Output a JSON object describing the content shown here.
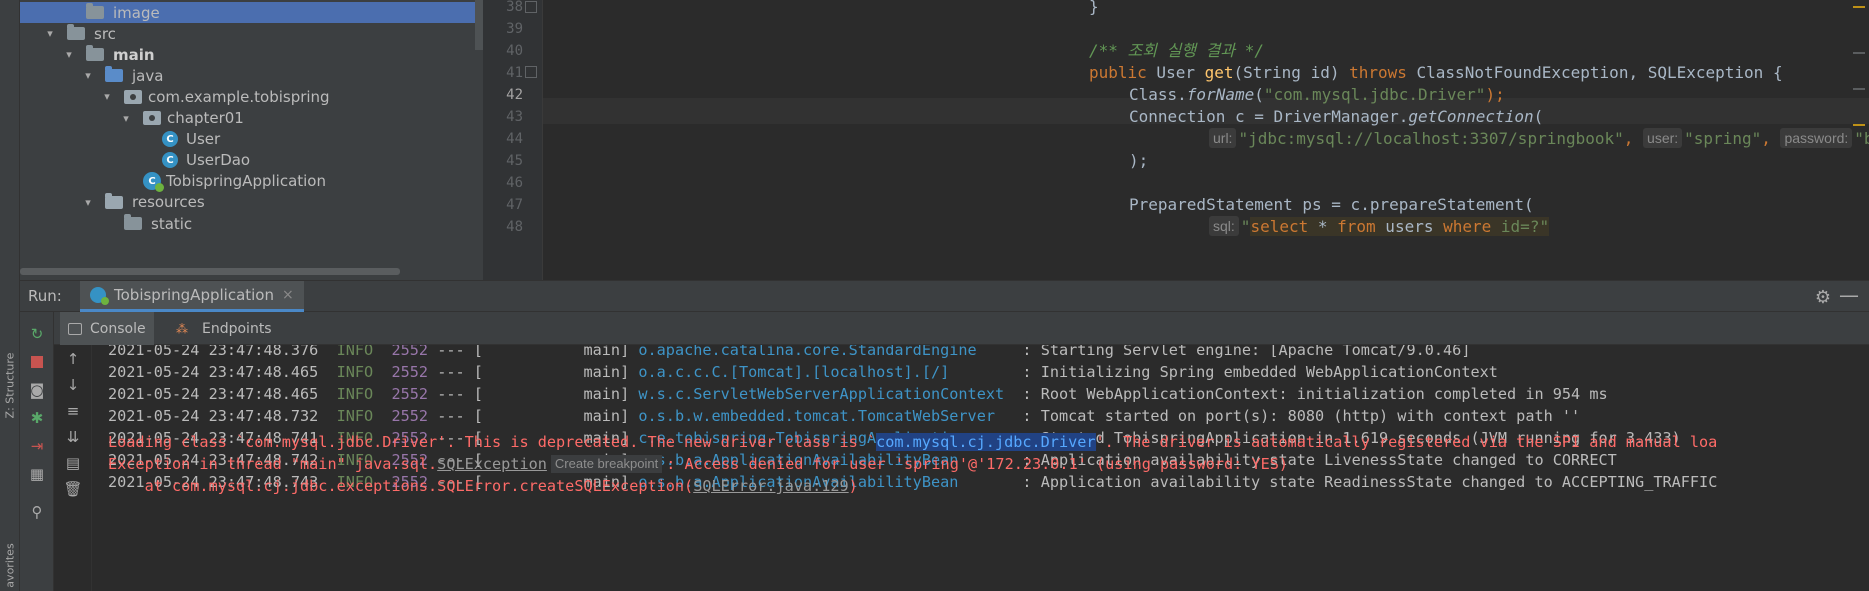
{
  "left_strip": {
    "structure_label": "Z: Structure",
    "favorites_label": "avorites"
  },
  "project_tree": {
    "items": [
      {
        "label": "image",
        "depth": 2,
        "arrow": "",
        "icon": "folder",
        "selected": true
      },
      {
        "label": "src",
        "depth": 1,
        "arrow": "▾",
        "icon": "folder"
      },
      {
        "label": "main",
        "depth": 2,
        "arrow": "▾",
        "icon": "folder"
      },
      {
        "label": "java",
        "depth": 3,
        "arrow": "▾",
        "icon": "folder"
      },
      {
        "label": "com.example.tobispring",
        "depth": 4,
        "arrow": "▾",
        "icon": "package"
      },
      {
        "label": "chapter01",
        "depth": 5,
        "arrow": "▾",
        "icon": "package"
      },
      {
        "label": "User",
        "depth": 6,
        "arrow": "",
        "icon": "class"
      },
      {
        "label": "UserDao",
        "depth": 6,
        "arrow": "",
        "icon": "class"
      },
      {
        "label": "TobispringApplication",
        "depth": 5,
        "arrow": "",
        "icon": "spring"
      },
      {
        "label": "resources",
        "depth": 3,
        "arrow": "▾",
        "icon": "folder"
      },
      {
        "label": "static",
        "depth": 4,
        "arrow": "",
        "icon": "folder"
      }
    ]
  },
  "editor": {
    "line_numbers": [
      "38",
      "39",
      "40",
      "41",
      "42",
      "43",
      "44",
      "45",
      "46",
      "47",
      "48"
    ],
    "current_line": "42",
    "code": {
      "l38": "}",
      "l40_comment": "/** 조회 실행 결과 */",
      "l41_public": "public",
      "l41_type": " User ",
      "l41_method": "get",
      "l41_params": "(String id) ",
      "l41_throws": "throws",
      "l41_rest": " ClassNotFoundException, SQLException {",
      "l42_class": "Class.",
      "l42_forname": "forName",
      "l42_paren": "(",
      "l42_str": "\"com.mysql.jdbc.Driver\"",
      "l42_end": ");",
      "l43_a": "Connection c = DriverManager.",
      "l43_getconn": "getConnection",
      "l43_paren": "(",
      "l44_hint_url": "url:",
      "l44_url": "\"jdbc:mysql://localhost:3307/springbook\"",
      "l44_comma1": ", ",
      "l44_hint_user": "user:",
      "l44_user": "\"spring\"",
      "l44_comma2": ", ",
      "l44_hint_pass": "password:",
      "l44_pass": "\"book\"",
      "l45": ");",
      "l47": "PreparedStatement ps = c.prepareStatement(",
      "l48_hint": "sql:",
      "l48_q1": "\"",
      "l48_select": "select",
      "l48_star": " * ",
      "l48_from": "from",
      "l48_users": " users ",
      "l48_where": "where",
      "l48_rest": " id=?\""
    }
  },
  "run_window": {
    "title": "Run:",
    "tab_label": "TobispringApplication",
    "tab_close": "×",
    "gear": "⚙",
    "minimize": "—"
  },
  "console_tabs": {
    "console": "Console",
    "endpoints": "Endpoints"
  },
  "console": {
    "log_lines": [
      {
        "ts": "2021-05-24 23:47:48.376",
        "level": "INFO",
        "pid": "2552",
        "mid": " --- [           main] ",
        "logger": "o.apache.catalina.core.StandardEngine   ",
        "msg": ": Starting Servlet engine: [Apache Tomcat/9.0.46]"
      },
      {
        "ts": "2021-05-24 23:47:48.465",
        "level": "INFO",
        "pid": "2552",
        "mid": " --- [           main] ",
        "logger": "o.a.c.c.C.[Tomcat].[localhost].[/]      ",
        "msg": ": Initializing Spring embedded WebApplicationContext"
      },
      {
        "ts": "2021-05-24 23:47:48.465",
        "level": "INFO",
        "pid": "2552",
        "mid": " --- [           main] ",
        "logger": "w.s.c.ServletWebServerApplicationContext",
        "msg": ": Root WebApplicationContext: initialization completed in 954 ms"
      },
      {
        "ts": "2021-05-24 23:47:48.732",
        "level": "INFO",
        "pid": "2552",
        "mid": " --- [           main] ",
        "logger": "o.s.b.w.embedded.tomcat.TomcatWebServer ",
        "msg": ": Tomcat started on port(s): 8080 (http) with context path ''"
      },
      {
        "ts": "2021-05-24 23:47:48.741",
        "level": "INFO",
        "pid": "2552",
        "mid": " --- [           main] ",
        "logger": "c.e.tobispring.TobispringApplication    ",
        "msg": ": Started TobispringApplication in 1.619 seconds (JVM running for 3.433)"
      },
      {
        "ts": "2021-05-24 23:47:48.742",
        "level": "INFO",
        "pid": "2552",
        "mid": " --- [           main] ",
        "logger": "o.s.b.a.ApplicationAvailabilityBean     ",
        "msg": ": Application availability state LivenessState changed to CORRECT"
      },
      {
        "ts": "2021-05-24 23:47:48.743",
        "level": "INFO",
        "pid": "2552",
        "mid": " --- [           main] ",
        "logger": "o.s.b.a.ApplicationAvailabilityBean     ",
        "msg": ": Application availability state ReadinessState changed to ACCEPTING_TRAFFIC"
      }
    ],
    "driver_warning_a": "Loading class `com.mysql.jdbc.Driver'. This is deprecated. The new driver class is `",
    "driver_warning_sel": "com.mysql.cj.jdbc.Driver",
    "driver_warning_b": "'. The driver is automatically registered via the SPI and manual loa",
    "exception_a": "Exception in thread \"main\" java.sql.",
    "exception_link": "SQLException",
    "exception_hint": "Create breakpoint",
    "exception_b": ": Access denied for user 'spring'@'172.23.0.1' (using password: YES)",
    "stack_a": "    at com.mysql.cj.jdbc.exceptions.SQLError.createSQLException(",
    "stack_link": "SQLError.java:129",
    "stack_b": ")"
  },
  "colors": {
    "selection": "#4b6eaf",
    "error_text": "#ff6b68",
    "info_level": "#6a8759",
    "logger": "#3e94c7"
  }
}
